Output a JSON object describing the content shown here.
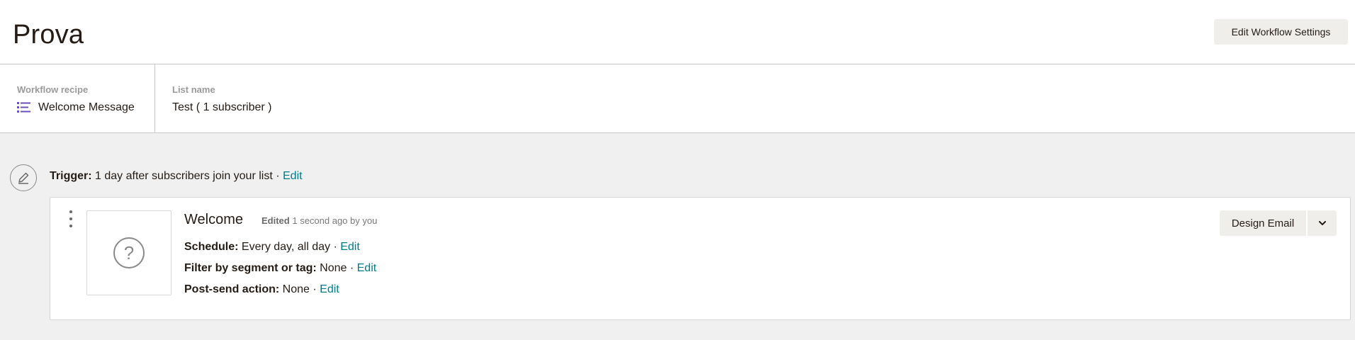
{
  "header": {
    "title": "Prova",
    "settings_button": "Edit Workflow Settings"
  },
  "meta": {
    "recipe_label": "Workflow recipe",
    "recipe_icon": "list-icon",
    "recipe_value": "Welcome Message",
    "list_label": "List name",
    "list_value": "Test ( 1 subscriber )"
  },
  "trigger": {
    "icon": "pencil-circle-icon",
    "label": "Trigger:",
    "text": " 1 day after subscribers join your list · ",
    "edit": "Edit"
  },
  "email": {
    "name": "Welcome",
    "edited_label": "Edited",
    "edited_text": " 1 second ago by you",
    "thumbnail_icon": "question-mark-icon",
    "schedule_label": "Schedule:",
    "schedule_value": " Every day, all day · ",
    "schedule_edit": "Edit",
    "filter_label": "Filter by segment or tag:",
    "filter_value": " None · ",
    "filter_edit": "Edit",
    "postsend_label": "Post-send action:",
    "postsend_value": " None · ",
    "postsend_edit": "Edit",
    "design_button": "Design Email",
    "caret_icon": "chevron-down-icon"
  },
  "colors": {
    "link": "#007c89",
    "accent_icon": "#6b4fbb",
    "button_bg": "#efeeea",
    "page_bg": "#f0f0f0"
  }
}
